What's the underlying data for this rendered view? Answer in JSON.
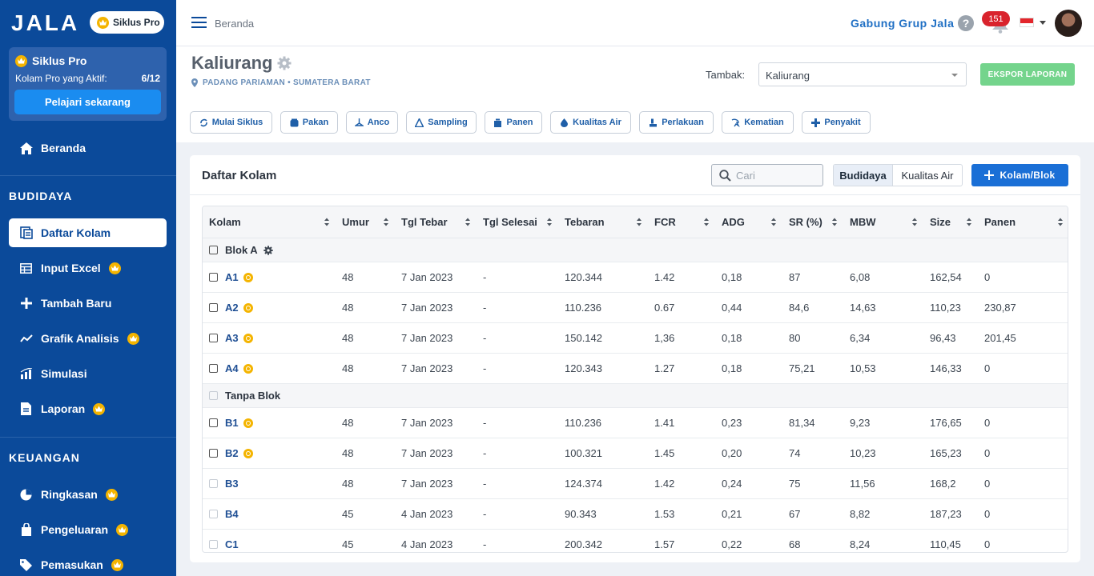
{
  "sidebar": {
    "logo": "JALA",
    "pro_pill": "Siklus Pro",
    "promo": {
      "title": "Siklus Pro",
      "subtitle": "Kolam Pro yang Aktif:",
      "count": "6/12",
      "button": "Pelajari sekarang"
    },
    "home": "Beranda",
    "section_budidaya": "BUDIDAYA",
    "budidaya_items": [
      {
        "label": "Daftar Kolam",
        "icon": "pond-list-icon",
        "pro": false,
        "active": true
      },
      {
        "label": "Input Excel",
        "icon": "table-icon",
        "pro": true
      },
      {
        "label": "Tambah Baru",
        "icon": "plus-icon",
        "pro": false
      },
      {
        "label": "Grafik Analisis",
        "icon": "line-chart-icon",
        "pro": true
      },
      {
        "label": "Simulasi",
        "icon": "bar-chart-icon",
        "pro": false
      },
      {
        "label": "Laporan",
        "icon": "report-icon",
        "pro": true
      }
    ],
    "section_keuangan": "KEUANGAN",
    "keuangan_items": [
      {
        "label": "Ringkasan",
        "icon": "pie-chart-icon",
        "pro": true
      },
      {
        "label": "Pengeluaran",
        "icon": "shopping-bag-icon",
        "pro": true
      },
      {
        "label": "Pemasukan",
        "icon": "tag-icon",
        "pro": true
      }
    ]
  },
  "topbar": {
    "breadcrumb": "Beranda",
    "join_group": "Gabung Grup Jala",
    "notification_count": "151"
  },
  "header": {
    "title": "Kaliurang",
    "location": "PADANG PARIAMAN • SUMATERA BARAT",
    "tambak_label": "Tambak:",
    "tambak_value": "Kaliurang",
    "export_button": "EKSPOR LAPORAN",
    "actions": [
      {
        "label": "Mulai Siklus",
        "icon": "cycle-icon"
      },
      {
        "label": "Pakan",
        "icon": "feed-icon"
      },
      {
        "label": "Anco",
        "icon": "anco-icon"
      },
      {
        "label": "Sampling",
        "icon": "sampling-icon"
      },
      {
        "label": "Panen",
        "icon": "harvest-icon"
      },
      {
        "label": "Kualitas Air",
        "icon": "water-drop-icon"
      },
      {
        "label": "Perlakuan",
        "icon": "treatment-icon"
      },
      {
        "label": "Kematian",
        "icon": "mortality-icon"
      },
      {
        "label": "Penyakit",
        "icon": "disease-icon"
      }
    ]
  },
  "card": {
    "title": "Daftar Kolam",
    "search_placeholder": "Cari",
    "tab_active": "Budidaya",
    "tab_inactive": "Kualitas Air",
    "add_button": "Kolam/Blok"
  },
  "table": {
    "columns": [
      "Kolam",
      "Umur",
      "Tgl Tebar",
      "Tgl Selesai",
      "Tebaran",
      "FCR",
      "ADG",
      "SR (%)",
      "MBW",
      "Size",
      "Panen"
    ],
    "groups": [
      {
        "name": "Blok A",
        "rows": [
          {
            "kolam": "A1",
            "pro": true,
            "umur": "48",
            "tgl_tebar": "7 Jan 2023",
            "tgl_selesai": "-",
            "tebaran": "120.344",
            "fcr": "1.42",
            "adg": "0,18",
            "sr": "87",
            "mbw": "6,08",
            "size": "162,54",
            "panen": "0"
          },
          {
            "kolam": "A2",
            "pro": true,
            "umur": "48",
            "tgl_tebar": "7 Jan 2023",
            "tgl_selesai": "-",
            "tebaran": "110.236",
            "fcr": "0.67",
            "adg": "0,44",
            "sr": "84,6",
            "mbw": "14,63",
            "size": "110,23",
            "panen": "230,87"
          },
          {
            "kolam": "A3",
            "pro": true,
            "umur": "48",
            "tgl_tebar": "7 Jan 2023",
            "tgl_selesai": "-",
            "tebaran": "150.142",
            "fcr": "1,36",
            "adg": "0,18",
            "sr": "80",
            "mbw": "6,34",
            "size": "96,43",
            "panen": "201,45"
          },
          {
            "kolam": "A4",
            "pro": true,
            "umur": "48",
            "tgl_tebar": "7 Jan 2023",
            "tgl_selesai": "-",
            "tebaran": "120.343",
            "fcr": "1.27",
            "adg": "0,18",
            "sr": "75,21",
            "mbw": "10,53",
            "size": "146,33",
            "panen": "0"
          }
        ]
      },
      {
        "name": "Tanpa Blok",
        "rows": [
          {
            "kolam": "B1",
            "pro": true,
            "umur": "48",
            "tgl_tebar": "7 Jan 2023",
            "tgl_selesai": "-",
            "tebaran": "110.236",
            "fcr": "1.41",
            "adg": "0,23",
            "sr": "81,34",
            "mbw": "9,23",
            "size": "176,65",
            "panen": "0"
          },
          {
            "kolam": "B2",
            "pro": true,
            "umur": "48",
            "tgl_tebar": "7 Jan 2023",
            "tgl_selesai": "-",
            "tebaran": "100.321",
            "fcr": "1.45",
            "adg": "0,20",
            "sr": "74",
            "mbw": "10,23",
            "size": "165,23",
            "panen": "0"
          },
          {
            "kolam": "B3",
            "pro": false,
            "umur": "48",
            "tgl_tebar": "7 Jan 2023",
            "tgl_selesai": "-",
            "tebaran": "124.374",
            "fcr": "1.42",
            "adg": "0,24",
            "sr": "75",
            "mbw": "11,56",
            "size": "168,2",
            "panen": "0"
          },
          {
            "kolam": "B4",
            "pro": false,
            "umur": "45",
            "tgl_tebar": "4 Jan 2023",
            "tgl_selesai": "-",
            "tebaran": "90.343",
            "fcr": "1.53",
            "adg": "0,21",
            "sr": "67",
            "mbw": "8,82",
            "size": "187,23",
            "panen": "0"
          },
          {
            "kolam": "C1",
            "pro": false,
            "umur": "45",
            "tgl_tebar": "4 Jan 2023",
            "tgl_selesai": "-",
            "tebaran": "200.342",
            "fcr": "1.57",
            "adg": "0,22",
            "sr": "68",
            "mbw": "8,24",
            "size": "110,45",
            "panen": "0"
          }
        ]
      }
    ]
  },
  "colors": {
    "sidebar": "#0b4a9a",
    "accent": "#1a6fd6",
    "pro_gold": "#f4b400",
    "export_green": "#74d48c",
    "badge_red": "#d9232d"
  }
}
